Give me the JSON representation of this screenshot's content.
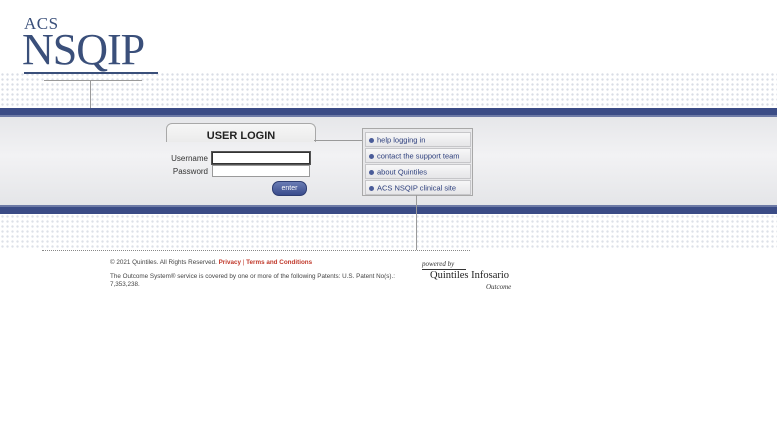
{
  "logo": {
    "top": "ACS",
    "main": "NSQIP"
  },
  "login": {
    "title": "USER LOGIN",
    "username_label": "Username",
    "password_label": "Password",
    "username_value": "",
    "password_value": "",
    "enter_label": "enter"
  },
  "help_links": [
    {
      "label": "help logging in"
    },
    {
      "label": "contact the support team"
    },
    {
      "label": "about Quintiles"
    },
    {
      "label": "ACS NSQIP clinical site"
    }
  ],
  "footer": {
    "copyright": "© 2021 Quintiles. All Rights Reserved.",
    "privacy": "Privacy",
    "separator": "|",
    "terms": "Terms and Conditions",
    "patent": "The Outcome System® service is covered by one or more of the following Patents: U.S. Patent No(s).: 7,353,238."
  },
  "powered_by": {
    "prefix": "powered by",
    "brand": "Quintiles Infosario",
    "sub": "Outcome"
  },
  "colors": {
    "accent": "#3b4c86",
    "link": "#2d3f7d",
    "footer_link": "#c0392b"
  }
}
